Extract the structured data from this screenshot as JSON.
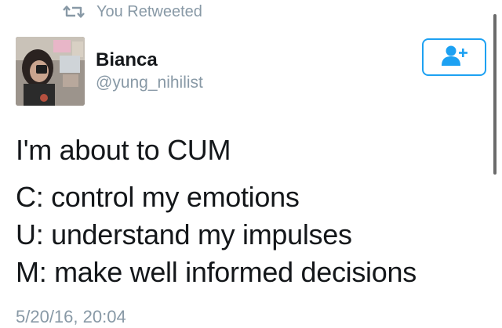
{
  "retweet_context": {
    "label": "You Retweeted",
    "icon": "retweet-icon"
  },
  "author": {
    "name": "Bianca",
    "handle": "@yung_nihilist",
    "avatar_icon": "avatar-photo"
  },
  "follow_button": {
    "icon": "add-user-icon",
    "accent": "#1da1f2"
  },
  "tweet": {
    "lines": [
      "I'm about to CUM",
      "C: control my emotions",
      "U: understand my impulses",
      "M: make well informed decisions"
    ],
    "timestamp": "5/20/16, 20:04"
  },
  "colors": {
    "text": "#14171a",
    "muted": "#8899a6",
    "accent": "#1da1f2"
  }
}
